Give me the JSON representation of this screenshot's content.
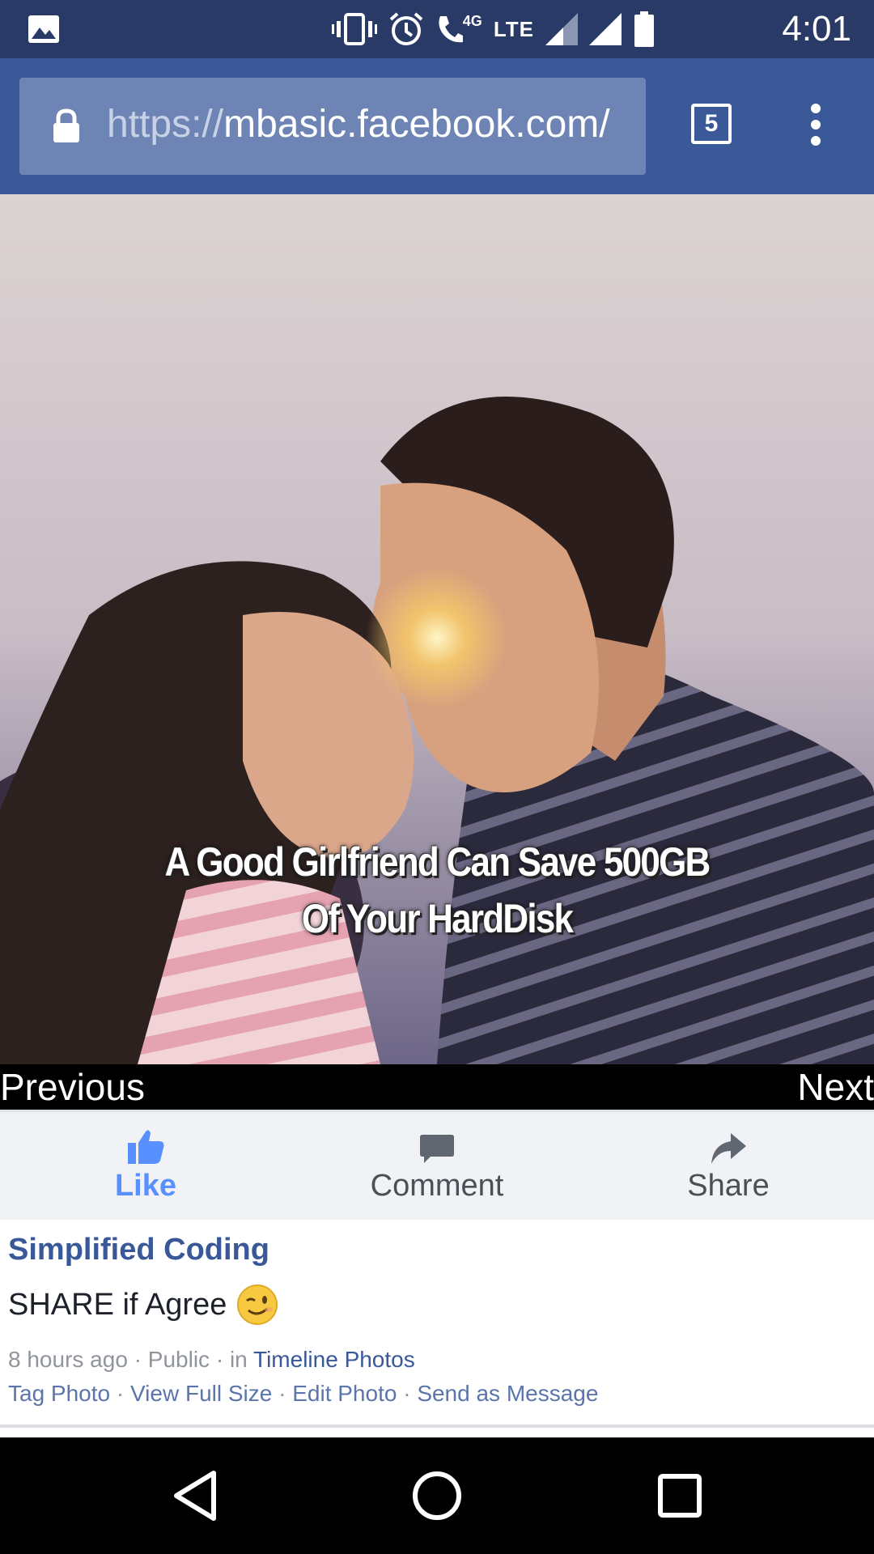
{
  "status_bar": {
    "time": "4:01",
    "network_label": "LTE",
    "network_sub": "4G",
    "icons": [
      "gallery-icon",
      "vibrate-icon",
      "alarm-icon",
      "wifi-call-icon",
      "signal-icon",
      "signal-icon",
      "battery-icon"
    ]
  },
  "browser": {
    "url_scheme": "https://",
    "url_host": "mbasic.facebook.com/",
    "tab_count": "5"
  },
  "photo": {
    "caption_line1": "A Good Girlfriend Can Save 500GB",
    "caption_line2": "Of Your HardDisk"
  },
  "photo_nav": {
    "previous": "Previous",
    "next": "Next"
  },
  "actions": {
    "like": "Like",
    "comment": "Comment",
    "share": "Share"
  },
  "post": {
    "author": "Simplified Coding",
    "message": "SHARE if Agree",
    "emoji": "wink-emoji",
    "time": "8 hours ago",
    "visibility": "Public",
    "in_label": "in",
    "album": "Timeline Photos",
    "separator": "·",
    "links": [
      "Tag Photo",
      "View Full Size",
      "Edit Photo",
      "Send as Message"
    ]
  },
  "colors": {
    "status_bar": "#283a65",
    "url_bar": "#3b5998",
    "like_active": "#5890ff",
    "link": "#385898"
  }
}
